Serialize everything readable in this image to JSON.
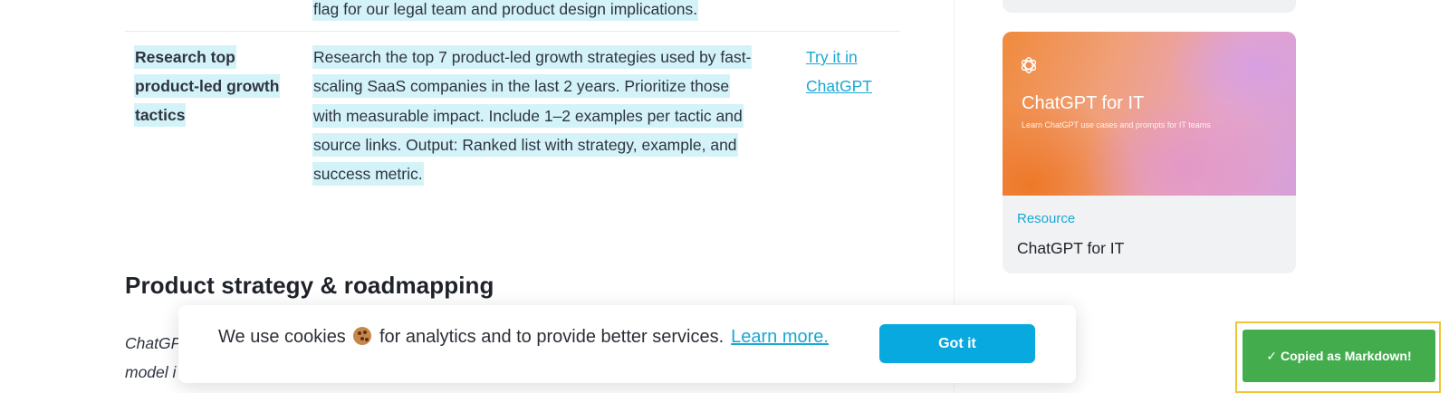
{
  "table": {
    "prev_row_tail": "flag for our legal team and product design implications.",
    "row": {
      "title_lines": [
        "Research top",
        "product-led growth",
        "tactics"
      ],
      "prompt_lines": [
        "Research the top 7 product-led growth strategies used by fast-",
        "scaling SaaS companies in the last 2 years. Prioritize those",
        "with measurable impact. Include 1–2 examples per tactic and",
        "source links. Output: Ranked list with strategy, example, and",
        "success metric."
      ],
      "link_lines": [
        "Try it in",
        "ChatGPT"
      ]
    }
  },
  "section": {
    "heading": "Product strategy & roadmapping",
    "intro_line1": "ChatGP",
    "intro_line2": "model i"
  },
  "sidebar": {
    "card": {
      "image_title": "ChatGPT for IT",
      "image_subtitle": "Learn ChatGPT use cases and prompts for IT teams",
      "tag": "Resource",
      "title": "ChatGPT for IT",
      "logo_icon": "openai-logo-icon"
    }
  },
  "cookie_banner": {
    "text_before": "We use cookies",
    "text_after": "for analytics and to provide better services.",
    "emoji_icon": "cookie-icon",
    "learn_more": "Learn more.",
    "button": "Got it"
  },
  "toast": {
    "message": "✓ Copied as Markdown!"
  },
  "colors": {
    "accent": "#1aa7d4",
    "highlight": "#d3f3f8",
    "button": "#08a9df",
    "toast": "#43ad4e",
    "toast_outline": "#f2c334"
  }
}
